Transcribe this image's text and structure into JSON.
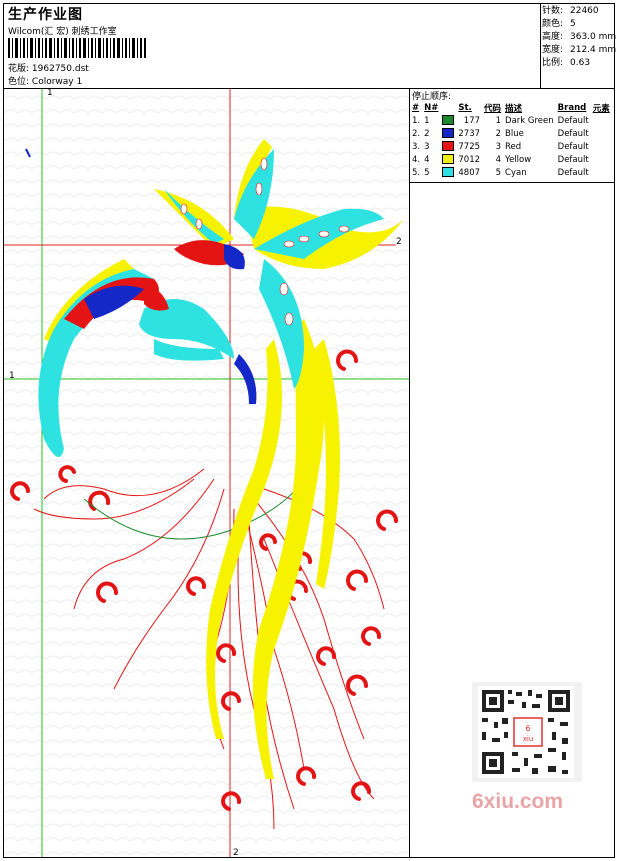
{
  "header": {
    "title": "生产作业图",
    "studio": "Wilcom(汇 宏) 刺绣工作室",
    "design_label": "花版:",
    "design_value": "1962750.dst",
    "colorway_label": "色位:",
    "colorway_value": "Colorway 1"
  },
  "stats": [
    {
      "label": "针数:",
      "value": "22460"
    },
    {
      "label": "颜色:",
      "value": "5"
    },
    {
      "label": "高度:",
      "value": "363.0 mm"
    },
    {
      "label": "宽度:",
      "value": "212.4 mm"
    },
    {
      "label": "比例:",
      "value": "0.63"
    }
  ],
  "stop_sequence": {
    "title": "停止顺序:",
    "columns": [
      "#",
      "N#",
      "St.",
      "代码",
      "描述",
      "Brand",
      "元素"
    ],
    "rows": [
      {
        "idx": "1.",
        "n": "1",
        "color": "#1b8a2c",
        "st": "177",
        "code": "1",
        "desc": "Dark Green",
        "brand": "Default"
      },
      {
        "idx": "2.",
        "n": "2",
        "color": "#1428c8",
        "st": "2737",
        "code": "2",
        "desc": "Blue",
        "brand": "Default"
      },
      {
        "idx": "3.",
        "n": "3",
        "color": "#e81212",
        "st": "7725",
        "code": "3",
        "desc": "Red",
        "brand": "Default"
      },
      {
        "idx": "4.",
        "n": "4",
        "color": "#f2ee10",
        "st": "7012",
        "code": "4",
        "desc": "Yellow",
        "brand": "Default"
      },
      {
        "idx": "5.",
        "n": "5",
        "color": "#2ee0e0",
        "st": "4807",
        "code": "5",
        "desc": "Cyan",
        "brand": "Default"
      }
    ]
  },
  "axes": {
    "h1": "1",
    "v1": "1",
    "h2": "2",
    "v2": "2"
  },
  "watermark": "6xiu.com"
}
